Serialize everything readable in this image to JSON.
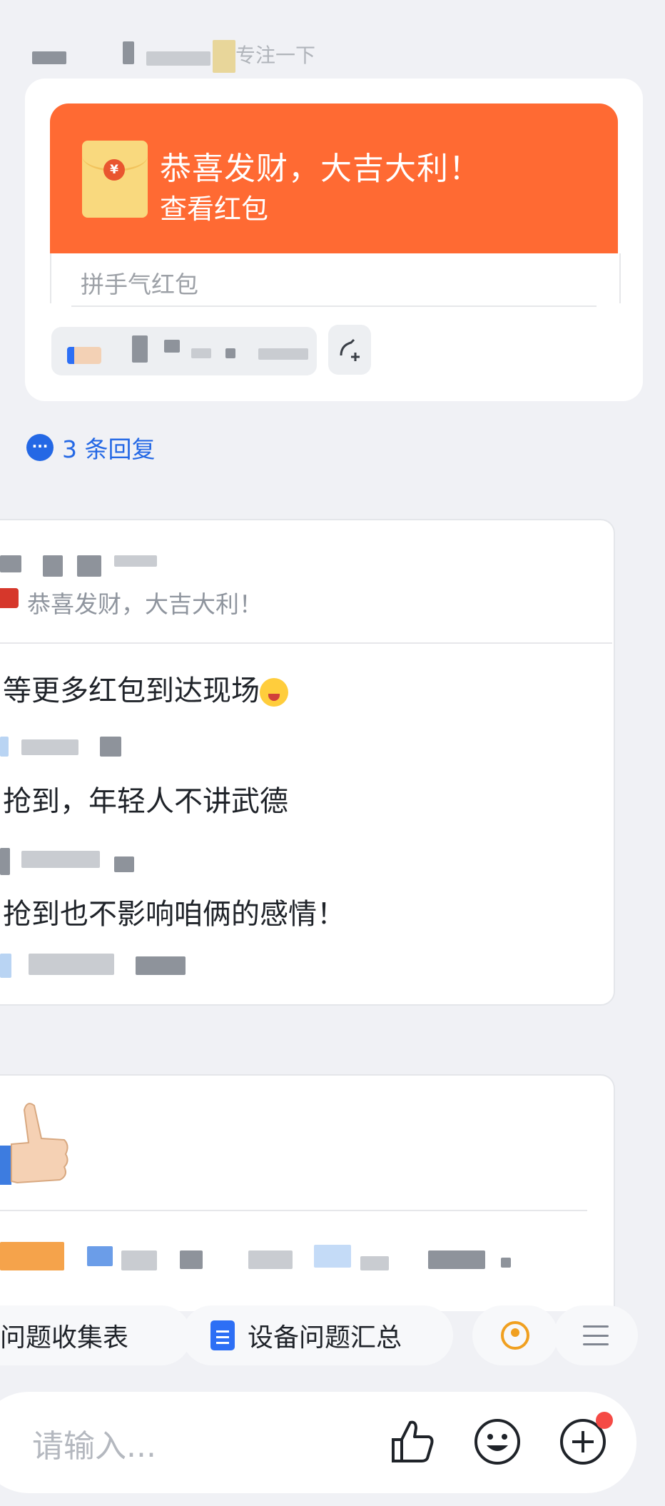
{
  "top_header": {
    "faded_text": "专注一下"
  },
  "red_packet": {
    "title": "恭喜发财，大吉大利！",
    "action": "查看红包",
    "type_label": "拼手气红包",
    "currency_symbol": "¥"
  },
  "replies": {
    "label": "3 条回复",
    "icon": "chat-bubble-icon"
  },
  "comment_card": {
    "quoted": "恭喜发财，大吉大利！",
    "messages": [
      {
        "text": "等更多红包到达现场"
      },
      {
        "text": "抢到，年轻人不讲武德"
      },
      {
        "text": "抢到也不影响咱俩的感情！"
      }
    ]
  },
  "quick_chips": [
    {
      "label": "问题收集表"
    },
    {
      "label": "设备问题汇总",
      "icon": "document-icon"
    },
    {
      "icon": "location-pin-icon"
    },
    {
      "icon": "menu-icon"
    }
  ],
  "input": {
    "placeholder": "请输入..."
  },
  "colors": {
    "accent": "#2468e5",
    "red_packet": "#ff6a33",
    "notify": "#f54a45"
  }
}
